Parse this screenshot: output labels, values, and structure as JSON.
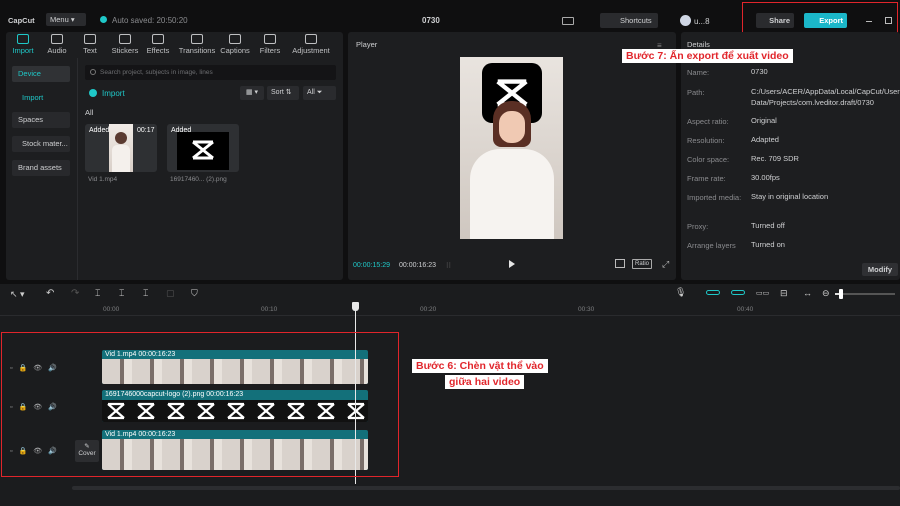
{
  "titlebar": {
    "app": "CapCut",
    "menu": "Menu",
    "autosave": "Auto saved: 20:50:20",
    "project": "0730",
    "shortcuts": "Shortcuts",
    "user": "u...8",
    "share": "Share",
    "export": "Export"
  },
  "tabs": [
    {
      "label": "Import"
    },
    {
      "label": "Audio"
    },
    {
      "label": "Text"
    },
    {
      "label": "Stickers"
    },
    {
      "label": "Effects"
    },
    {
      "label": "Transitions"
    },
    {
      "label": "Captions"
    },
    {
      "label": "Filters"
    },
    {
      "label": "Adjustment"
    }
  ],
  "sidebar": {
    "items": [
      {
        "label": "Device"
      },
      {
        "label": "Import"
      },
      {
        "label": "Spaces"
      },
      {
        "label": "Stock mater..."
      },
      {
        "label": "Brand assets"
      }
    ]
  },
  "media": {
    "search_placeholder": "Search project, subjects in image, lines",
    "import_btn": "Import",
    "sort": "Sort",
    "all_filter": "All",
    "section": "All",
    "items": [
      {
        "badge": "Added",
        "duration": "00:17",
        "name": "Vid 1.mp4"
      },
      {
        "badge": "Added",
        "name": "16917460... (2).png"
      }
    ]
  },
  "player": {
    "title": "Player",
    "current": "00:00:15:29",
    "total": "00:00:16:23",
    "ratio": "Ratio"
  },
  "details": {
    "title": "Details",
    "rows": [
      {
        "label": "Name:",
        "value": "0730"
      },
      {
        "label": "Path:",
        "value": "C:/Users/ACER/AppData/Local/CapCut/User Data/Projects/com.lveditor.draft/0730"
      },
      {
        "label": "Aspect ratio:",
        "value": "Original"
      },
      {
        "label": "Resolution:",
        "value": "Adapted"
      },
      {
        "label": "Color space:",
        "value": "Rec. 709 SDR"
      },
      {
        "label": "Frame rate:",
        "value": "30.00fps"
      },
      {
        "label": "Imported media:",
        "value": "Stay in original location"
      },
      {
        "label": "Proxy:",
        "value": "Turned off"
      },
      {
        "label": "Arrange layers",
        "value": "Turned on"
      }
    ],
    "modify": "Modify"
  },
  "timeline": {
    "ruler": [
      "00:00",
      "00:10",
      "00:20",
      "00:30",
      "00:40"
    ],
    "clips": [
      {
        "label": "Vid 1.mp4   00:00:16:23"
      },
      {
        "label": "1691746000capcut-logo (2).png   00:00:16:23"
      },
      {
        "label": "Vid 1.mp4   00:00:16:23"
      }
    ],
    "cover": "Cover"
  },
  "annotations": {
    "step7": "Bước 7:  Ấn export để xuất video",
    "step6_line1": "Bước 6:  Chèn vật thể vào",
    "step6_line2": "giữa hai video"
  },
  "colors": {
    "accent": "#1fc8c8",
    "export_bg": "#1bb7c9",
    "callout": "#e1262c",
    "clip": "#13707a"
  }
}
